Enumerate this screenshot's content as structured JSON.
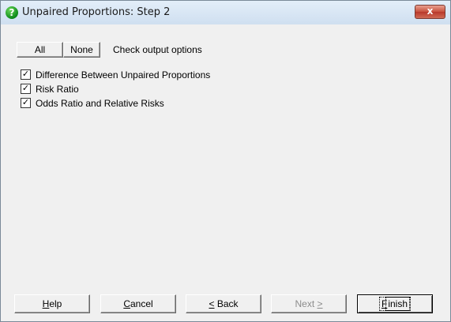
{
  "window": {
    "title": "Unpaired Proportions: Step 2",
    "close_label": "x"
  },
  "toolbar": {
    "all_label": "All",
    "none_label": "None",
    "instruction": "Check output options"
  },
  "options": [
    {
      "label": "Difference Between Unpaired Proportions",
      "checked": true
    },
    {
      "label": "Risk Ratio",
      "checked": true
    },
    {
      "label": "Odds Ratio and Relative Risks",
      "checked": true
    }
  ],
  "footer": {
    "help": {
      "mnemonic": "H",
      "rest": "elp"
    },
    "cancel": {
      "mnemonic": "C",
      "rest": "ancel"
    },
    "back": {
      "mnemonic": "<",
      "rest": " Back"
    },
    "next": {
      "rest": "Next ",
      "mnemonic": ">",
      "disabled": true
    },
    "finish": {
      "mnemonic": "F",
      "rest": "inish",
      "default": true
    }
  },
  "check_mark": "✓"
}
